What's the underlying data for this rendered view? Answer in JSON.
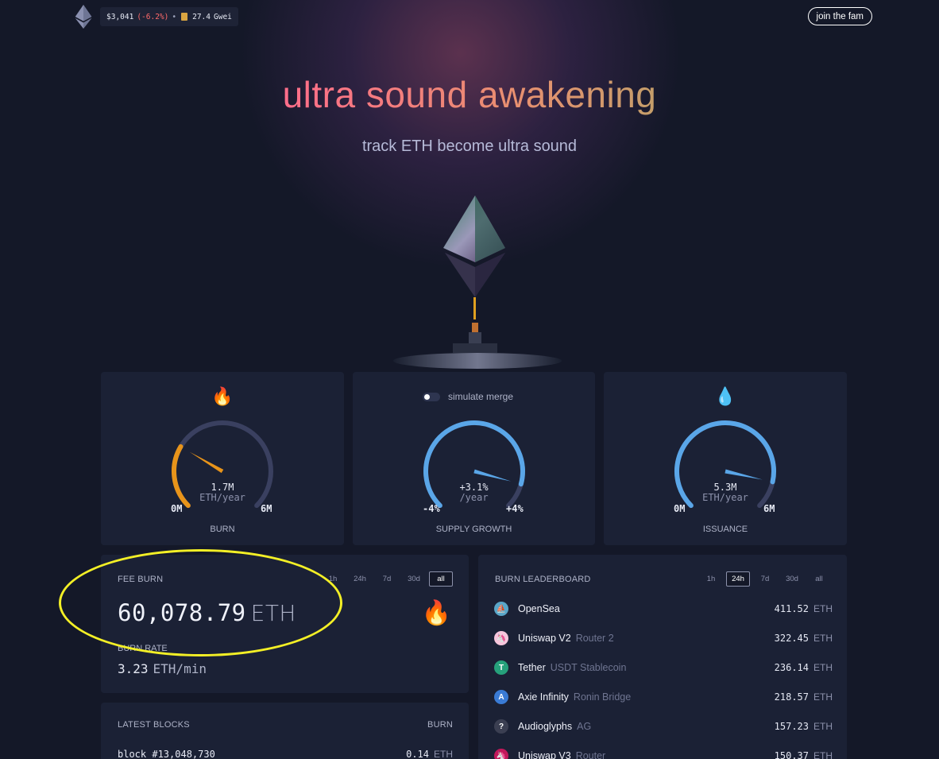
{
  "header": {
    "price": "$3,041",
    "change": "(-6.2%)",
    "separator": "•",
    "gas": "27.4",
    "gas_unit": "Gwei",
    "join_label": "join the fam"
  },
  "hero": {
    "title": "ultra sound awakening",
    "subtitle": "track ETH become ultra sound"
  },
  "gauges": {
    "burn": {
      "emoji": "🔥",
      "value": "1.7M",
      "unit": "ETH/year",
      "min": "0M",
      "max": "6M",
      "label": "BURN",
      "fraction": 0.28
    },
    "supply": {
      "toggle_label": "simulate merge",
      "value": "+3.1%",
      "unit": "/year",
      "min": "-4%",
      "max": "+4%",
      "label": "SUPPLY GROWTH",
      "fraction": 0.89
    },
    "issuance": {
      "emoji": "💧",
      "value": "5.3M",
      "unit": "ETH/year",
      "min": "0M",
      "max": "6M",
      "label": "ISSUANCE",
      "fraction": 0.88
    }
  },
  "fee_burn": {
    "title": "FEE BURN",
    "timeframes": [
      "1h",
      "24h",
      "7d",
      "30d",
      "all"
    ],
    "active": "all",
    "amount": "60,078.79",
    "unit": "ETH",
    "rate_label": "BURN RATE",
    "rate": "3.23",
    "rate_unit": "ETH/min",
    "emoji": "🔥"
  },
  "leaderboard": {
    "title": "BURN LEADERBOARD",
    "timeframes": [
      "1h",
      "24h",
      "7d",
      "30d",
      "all"
    ],
    "active": "24h",
    "rows": [
      {
        "name": "OpenSea",
        "detail": "",
        "amount": "411.52",
        "unit": "ETH",
        "color": "#5aa6c8",
        "glyph": "⛵"
      },
      {
        "name": "Uniswap V2",
        "detail": "Router 2",
        "amount": "322.45",
        "unit": "ETH",
        "color": "#f7c6dc",
        "glyph": "🦄"
      },
      {
        "name": "Tether",
        "detail": "USDT Stablecoin",
        "amount": "236.14",
        "unit": "ETH",
        "color": "#26a17b",
        "glyph": "T"
      },
      {
        "name": "Axie Infinity",
        "detail": "Ronin Bridge",
        "amount": "218.57",
        "unit": "ETH",
        "color": "#3a7bd5",
        "glyph": "A"
      },
      {
        "name": "Audioglyphs",
        "detail": "AG",
        "amount": "157.23",
        "unit": "ETH",
        "color": "#3b3f52",
        "glyph": "?"
      },
      {
        "name": "Uniswap V3",
        "detail": "Router",
        "amount": "150.37",
        "unit": "ETH",
        "color": "#c2185b",
        "glyph": "🦄"
      }
    ]
  },
  "latest_blocks": {
    "title": "LATEST BLOCKS",
    "col_burn": "BURN",
    "rows": [
      {
        "block": "block #13,048,730",
        "burn": "0.14",
        "unit": "ETH"
      }
    ]
  },
  "colors": {
    "burn_arc": "#e8941a",
    "blue_arc": "#5aa6e8",
    "track": "#3a4060",
    "highlight": "#f3ef26"
  }
}
